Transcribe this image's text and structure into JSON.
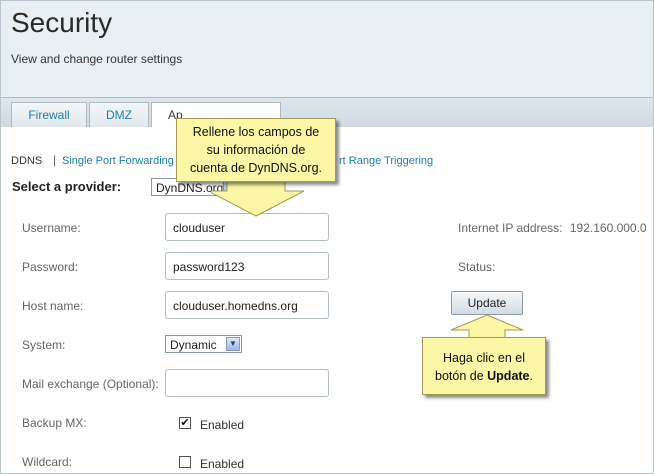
{
  "header": {
    "title": "Security",
    "subtitle": "View and change router settings"
  },
  "tabs": [
    {
      "label": "Firewall",
      "active": false
    },
    {
      "label": "DMZ",
      "active": false
    },
    {
      "label": "Ap",
      "active": true
    }
  ],
  "subnav": {
    "current": "DDNS",
    "separator": "|",
    "links": [
      "Single Port Forwarding",
      "rt Range Triggering"
    ]
  },
  "provider": {
    "label": "Select a provider:",
    "value": "DynDNS.org"
  },
  "form": {
    "username_label": "Username:",
    "username_value": "clouduser",
    "password_label": "Password:",
    "password_value": "password123",
    "hostname_label": "Host name:",
    "hostname_value": "clouduser.homedns.org",
    "system_label": "System:",
    "system_value": "Dynamic",
    "mail_label": "Mail exchange (Optional):",
    "mail_value": "",
    "backup_label": "Backup MX:",
    "backup_checked": true,
    "backup_check_text": "Enabled",
    "wildcard_label": "Wildcard:",
    "wildcard_checked": false,
    "wildcard_check_text": "Enabled"
  },
  "status_panel": {
    "ip_label": "Internet IP address:",
    "ip_value": "192.160.000.0",
    "status_label": "Status:",
    "update_label": "Update"
  },
  "callouts": {
    "fill_fields": {
      "line1": "Rellene los campos de",
      "line2": "su información de",
      "line3": "cuenta de DynDNS.org."
    },
    "update_hint": {
      "line1": "Haga clic en el",
      "line2_prefix": "botón de ",
      "line2_bold": "Update",
      "line2_suffix": "."
    }
  },
  "colors": {
    "header_bg": "#e8eff3",
    "link": "#1d7fa6",
    "callout_bg": "#fbf7a6"
  }
}
